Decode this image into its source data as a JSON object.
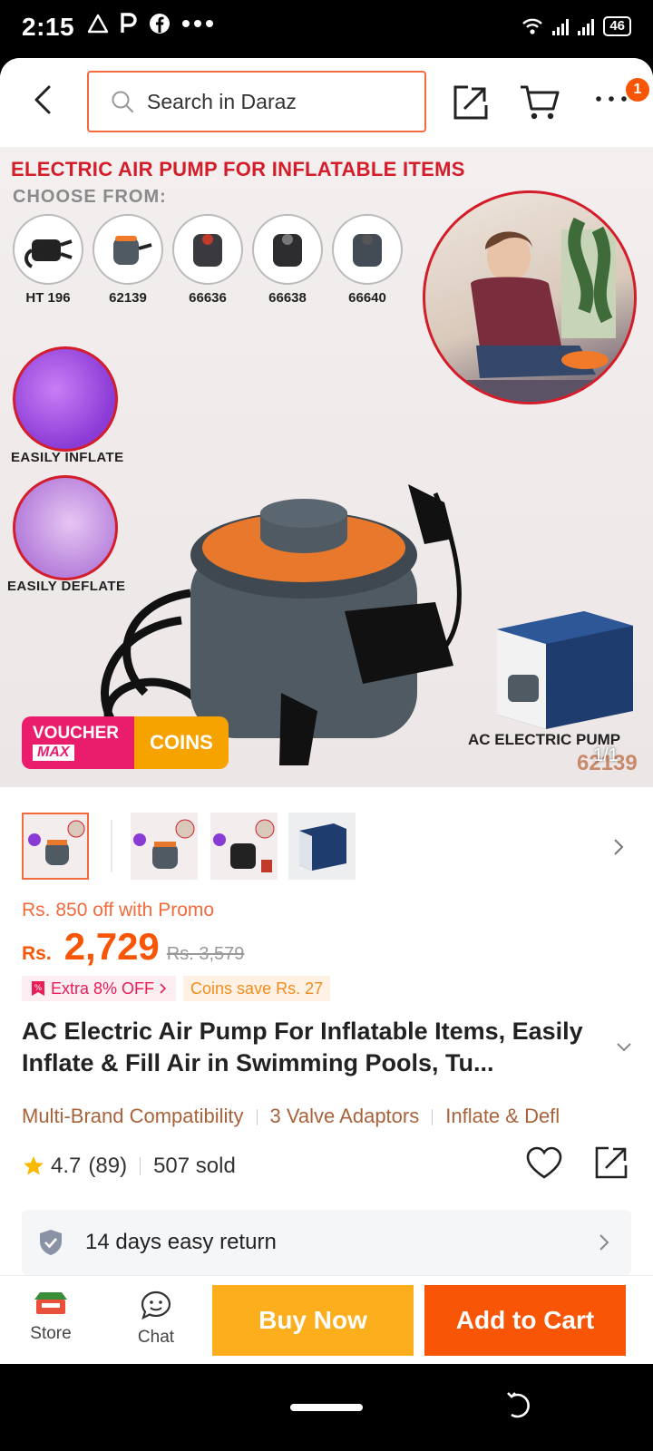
{
  "status_bar": {
    "time": "2:15",
    "left_icons": [
      "alert-icon",
      "parking-icon",
      "facebook-icon",
      "more-dots-icon"
    ],
    "battery": "46"
  },
  "header": {
    "search_placeholder": "Search in Daraz",
    "cart_count": "1"
  },
  "hero": {
    "title": "ELECTRIC AIR PUMP FOR INFLATABLE ITEMS",
    "choose_label": "CHOOSE FROM:",
    "variants": [
      "HT 196",
      "62139",
      "66636",
      "66638",
      "66640"
    ],
    "feature_1": "EASILY INFLATE",
    "feature_2": "EASILY DEFLATE",
    "voucher_line1": "VOUCHER",
    "voucher_line2": "MAX",
    "coins_label": "COINS",
    "caption": "AC ELECTRIC PUMP",
    "model": "62139",
    "counter": "1/1"
  },
  "thumbnails": {
    "count": 4,
    "active_index": 0
  },
  "price": {
    "promo": "Rs. 850 off with Promo",
    "currency": "Rs.",
    "value": "2,729",
    "original": "Rs. 3,579",
    "tag_extra": "Extra 8% OFF",
    "tag_coins": "Coins save Rs. 27"
  },
  "product": {
    "title": "AC Electric Air Pump For Inflatable Items, Easily Inflate & Fill Air in Swimming Pools, Tu...",
    "features": [
      "Multi-Brand Compatibility",
      "3 Valve Adaptors",
      "Inflate & Defl"
    ],
    "rating": "4.7",
    "reviews": "(89)",
    "sold": "507 sold"
  },
  "return_policy": {
    "text": "14 days easy return"
  },
  "actions": {
    "store_label": "Store",
    "chat_label": "Chat",
    "buy_now": "Buy Now",
    "add_to_cart": "Add to Cart"
  },
  "colors": {
    "brand_orange": "#f85606",
    "buy_yellow": "#fcae1c",
    "voucher_pink": "#ea1d6c",
    "coins_gold": "#f6a300"
  }
}
